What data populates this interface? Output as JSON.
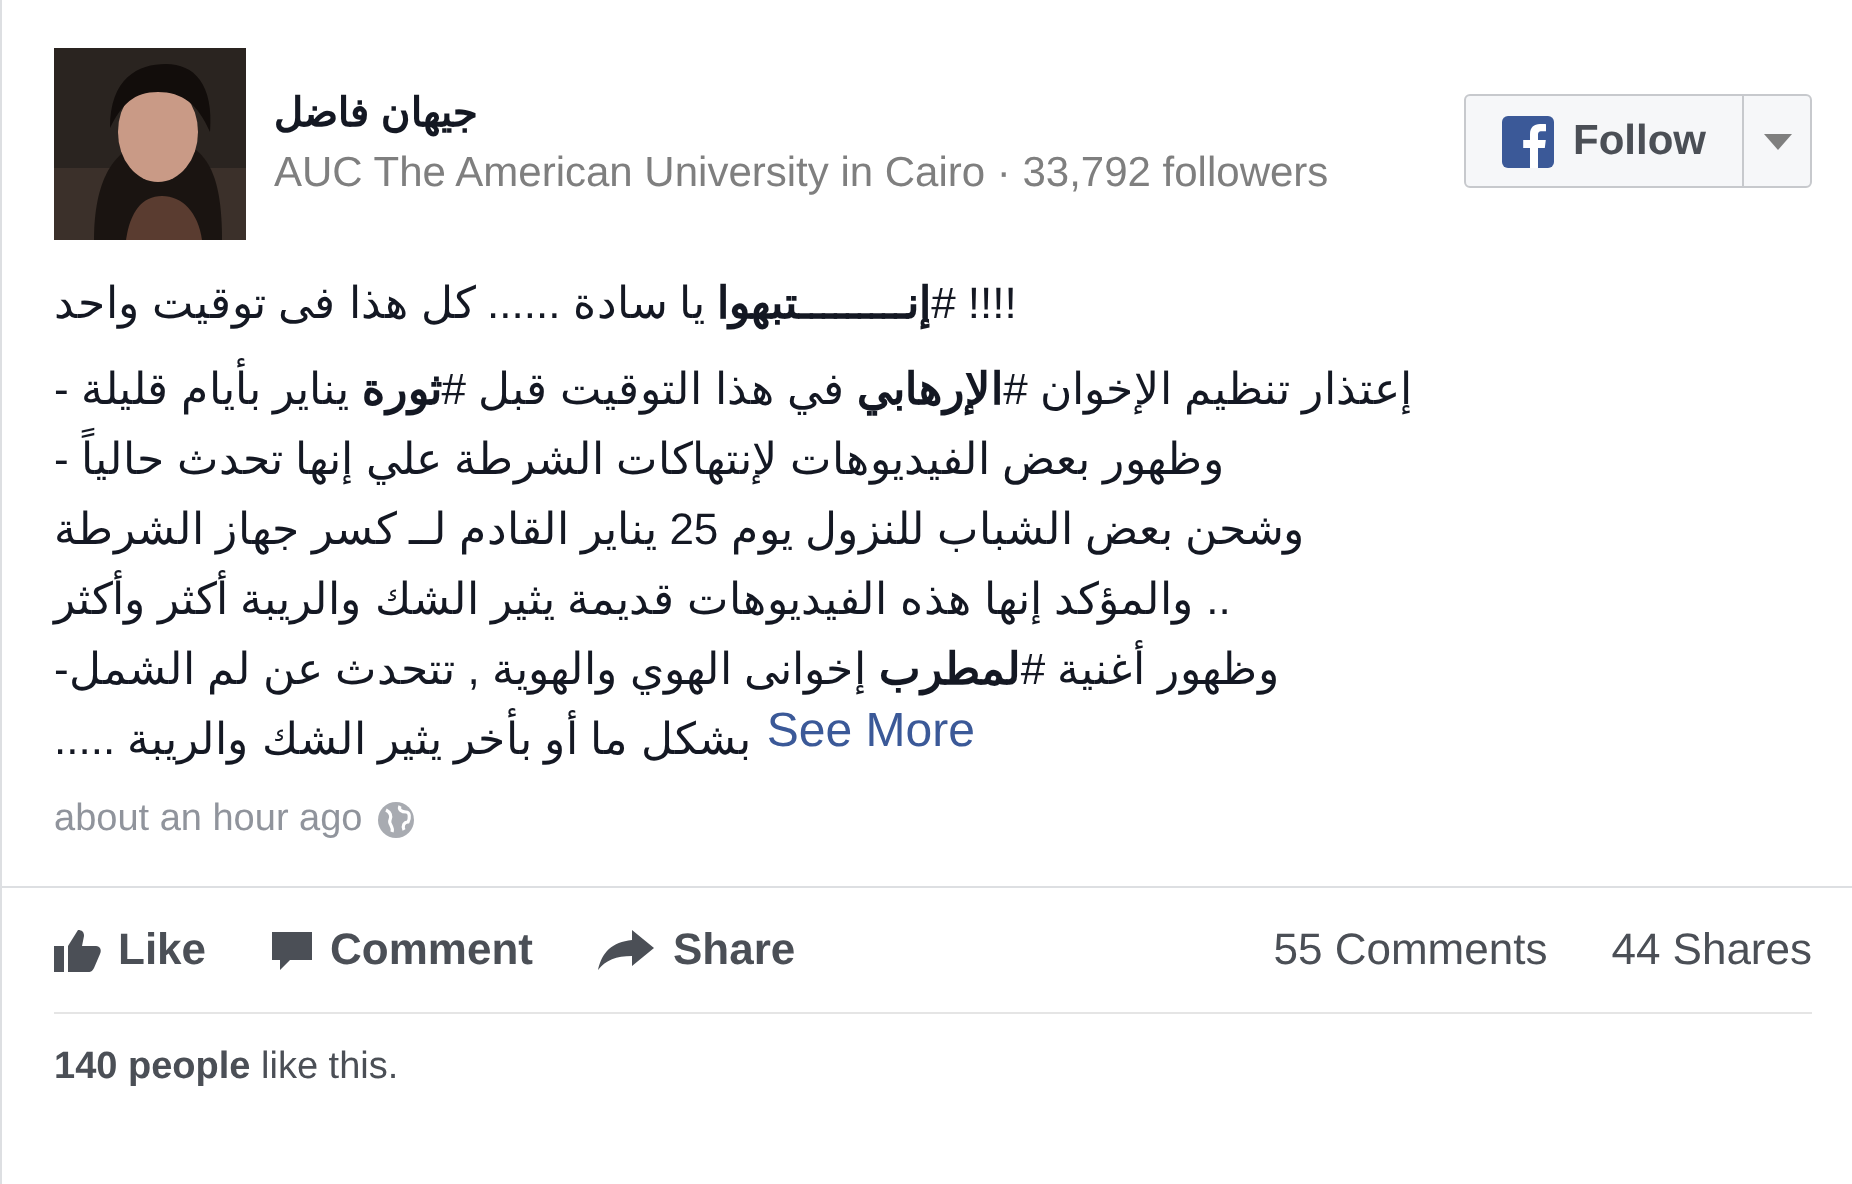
{
  "author": {
    "name": "جيهان فاضل",
    "subtitle": "AUC The American University in Cairo · 33,792 followers"
  },
  "follow_button": {
    "label": "Follow"
  },
  "post": {
    "lines": [
      "!!!! #**إنـــــــــتبهوا** يا سادة ...... كل هذا فى توقيت واحد"
    ],
    "paragraph": [
      "إعتذار تنظيم الإخوان #**الإرهابي** في هذا التوقيت قبل #**ثورة** يناير بأيام قليلة -",
      "وظهور بعض الفيديوهات لإنتهاكات الشرطة علي إنها تحدث حالياً -",
      "وشحن بعض الشباب للنزول يوم 25 يناير القادم لــ كسر جهاز الشرطة",
      ".. والمؤكد إنها هذه الفيديوهات قديمة يثير الشك والريبة أكثر وأكثر",
      "وظهور أغنية #**لمطرب** إخوانى الهوي والهوية , تتحدث عن لم الشمل-"
    ],
    "last_line": "بشكل ما أو بأخر يثير الشك والريبة .....",
    "see_more": "See More",
    "timestamp": "about an hour ago"
  },
  "actions": {
    "like": "Like",
    "comment": "Comment",
    "share": "Share"
  },
  "counts": {
    "comments": "55 Comments",
    "shares": "44 Shares"
  },
  "likes_summary": {
    "count": "140 people",
    "text": "like this."
  }
}
